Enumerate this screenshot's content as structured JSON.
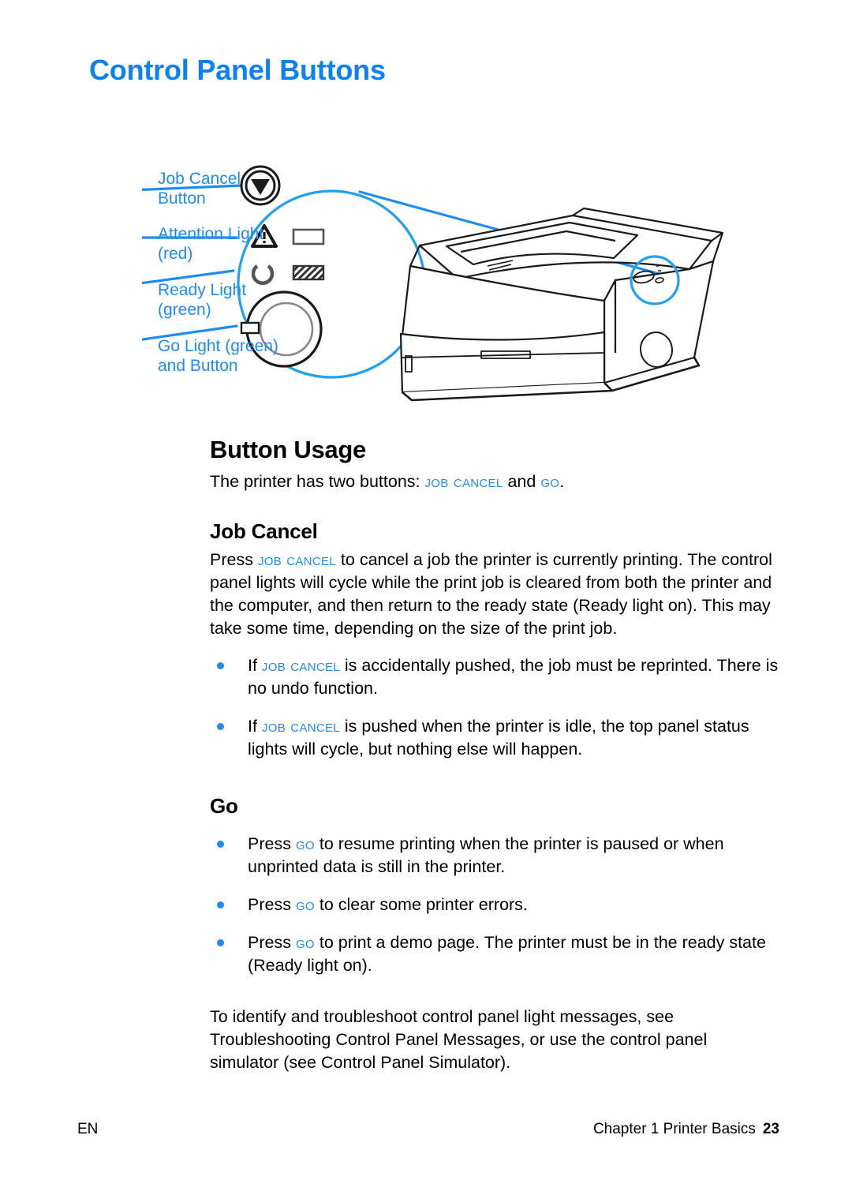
{
  "page": {
    "title": "Control Panel Buttons",
    "title_color": "#0a82f5",
    "accent_color": "#1f8cf5"
  },
  "figure": {
    "alt": "HP LaserJet printer with magnified view of the control panel",
    "callouts": [
      {
        "name": "job-cancel-button",
        "line1": "Job Cancel",
        "line2": "Button"
      },
      {
        "name": "attention-light",
        "line1": "Attention Light",
        "line2": "(red)"
      },
      {
        "name": "ready-light",
        "line1": "Ready Light",
        "line2": "(green)"
      },
      {
        "name": "go-light",
        "line1": "Go Light (green)",
        "line2": "and Button"
      }
    ],
    "icons": {
      "job_cancel": "circled-down-triangle-icon",
      "attention": "warning-triangle-icon",
      "attention_led": "led-rectangle-icon",
      "ready": "ready-c-ring-icon",
      "ready_led": "led-hatched-rectangle-icon",
      "go_button": "go-ring-button-icon"
    }
  },
  "button_usage": {
    "heading": "Button Usage",
    "intro_prefix": "The printer has two buttons: ",
    "intro_btn1": "Job Cancel",
    "intro_mid": " and ",
    "intro_btn2": "Go",
    "intro_suffix": "."
  },
  "job_cancel": {
    "heading": "Job Cancel",
    "para_prefix": "Press ",
    "para_btn": "Job Cancel",
    "para_body": " to cancel a job the printer is currently printing. The control panel lights will cycle while the print job is cleared from both the printer and the computer, and then return to the ready state (Ready light on). This may take some time, depending on the size of the print job.",
    "bullets": [
      {
        "prefix": "If ",
        "btn": "Job Cancel",
        "suffix": " is accidentally pushed, the job must be reprinted. There is no undo function."
      },
      {
        "prefix": "If ",
        "btn": "Job Cancel",
        "suffix": " is pushed when the printer is idle, the top panel status lights will cycle, but nothing else will happen."
      }
    ]
  },
  "go": {
    "heading": "Go",
    "bullets": [
      {
        "prefix": "Press ",
        "btn": "Go",
        "suffix": " to resume printing when the printer is paused or when unprinted data is still in the printer."
      },
      {
        "prefix": "Press ",
        "btn": "Go",
        "suffix": " to clear some printer errors."
      },
      {
        "prefix": "Press ",
        "btn": "Go",
        "suffix": " to print a demo page. The printer must be in the ready state (Ready light on)."
      }
    ]
  },
  "closing_paragraph": "To identify and troubleshoot control panel light messages, see Troubleshooting Control Panel Messages, or use the control panel simulator (see Control Panel Simulator).",
  "footer": {
    "left": "EN",
    "chapter": "Chapter 1 Printer Basics",
    "page_number": "23"
  }
}
